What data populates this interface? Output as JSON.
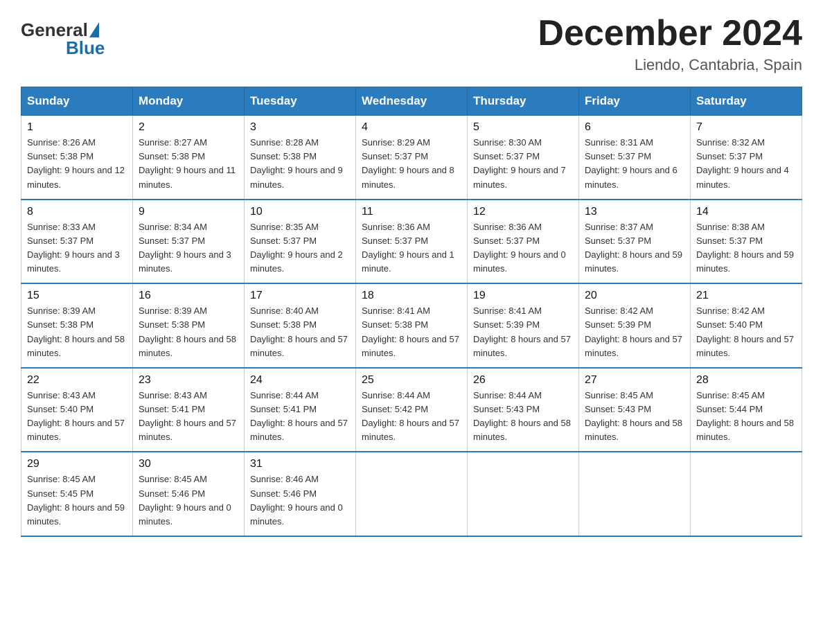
{
  "header": {
    "title": "December 2024",
    "location": "Liendo, Cantabria, Spain",
    "logo_general": "General",
    "logo_blue": "Blue"
  },
  "days_of_week": [
    "Sunday",
    "Monday",
    "Tuesday",
    "Wednesday",
    "Thursday",
    "Friday",
    "Saturday"
  ],
  "weeks": [
    [
      {
        "day": "1",
        "sunrise": "8:26 AM",
        "sunset": "5:38 PM",
        "daylight": "9 hours and 12 minutes."
      },
      {
        "day": "2",
        "sunrise": "8:27 AM",
        "sunset": "5:38 PM",
        "daylight": "9 hours and 11 minutes."
      },
      {
        "day": "3",
        "sunrise": "8:28 AM",
        "sunset": "5:38 PM",
        "daylight": "9 hours and 9 minutes."
      },
      {
        "day": "4",
        "sunrise": "8:29 AM",
        "sunset": "5:37 PM",
        "daylight": "9 hours and 8 minutes."
      },
      {
        "day": "5",
        "sunrise": "8:30 AM",
        "sunset": "5:37 PM",
        "daylight": "9 hours and 7 minutes."
      },
      {
        "day": "6",
        "sunrise": "8:31 AM",
        "sunset": "5:37 PM",
        "daylight": "9 hours and 6 minutes."
      },
      {
        "day": "7",
        "sunrise": "8:32 AM",
        "sunset": "5:37 PM",
        "daylight": "9 hours and 4 minutes."
      }
    ],
    [
      {
        "day": "8",
        "sunrise": "8:33 AM",
        "sunset": "5:37 PM",
        "daylight": "9 hours and 3 minutes."
      },
      {
        "day": "9",
        "sunrise": "8:34 AM",
        "sunset": "5:37 PM",
        "daylight": "9 hours and 3 minutes."
      },
      {
        "day": "10",
        "sunrise": "8:35 AM",
        "sunset": "5:37 PM",
        "daylight": "9 hours and 2 minutes."
      },
      {
        "day": "11",
        "sunrise": "8:36 AM",
        "sunset": "5:37 PM",
        "daylight": "9 hours and 1 minute."
      },
      {
        "day": "12",
        "sunrise": "8:36 AM",
        "sunset": "5:37 PM",
        "daylight": "9 hours and 0 minutes."
      },
      {
        "day": "13",
        "sunrise": "8:37 AM",
        "sunset": "5:37 PM",
        "daylight": "8 hours and 59 minutes."
      },
      {
        "day": "14",
        "sunrise": "8:38 AM",
        "sunset": "5:37 PM",
        "daylight": "8 hours and 59 minutes."
      }
    ],
    [
      {
        "day": "15",
        "sunrise": "8:39 AM",
        "sunset": "5:38 PM",
        "daylight": "8 hours and 58 minutes."
      },
      {
        "day": "16",
        "sunrise": "8:39 AM",
        "sunset": "5:38 PM",
        "daylight": "8 hours and 58 minutes."
      },
      {
        "day": "17",
        "sunrise": "8:40 AM",
        "sunset": "5:38 PM",
        "daylight": "8 hours and 57 minutes."
      },
      {
        "day": "18",
        "sunrise": "8:41 AM",
        "sunset": "5:38 PM",
        "daylight": "8 hours and 57 minutes."
      },
      {
        "day": "19",
        "sunrise": "8:41 AM",
        "sunset": "5:39 PM",
        "daylight": "8 hours and 57 minutes."
      },
      {
        "day": "20",
        "sunrise": "8:42 AM",
        "sunset": "5:39 PM",
        "daylight": "8 hours and 57 minutes."
      },
      {
        "day": "21",
        "sunrise": "8:42 AM",
        "sunset": "5:40 PM",
        "daylight": "8 hours and 57 minutes."
      }
    ],
    [
      {
        "day": "22",
        "sunrise": "8:43 AM",
        "sunset": "5:40 PM",
        "daylight": "8 hours and 57 minutes."
      },
      {
        "day": "23",
        "sunrise": "8:43 AM",
        "sunset": "5:41 PM",
        "daylight": "8 hours and 57 minutes."
      },
      {
        "day": "24",
        "sunrise": "8:44 AM",
        "sunset": "5:41 PM",
        "daylight": "8 hours and 57 minutes."
      },
      {
        "day": "25",
        "sunrise": "8:44 AM",
        "sunset": "5:42 PM",
        "daylight": "8 hours and 57 minutes."
      },
      {
        "day": "26",
        "sunrise": "8:44 AM",
        "sunset": "5:43 PM",
        "daylight": "8 hours and 58 minutes."
      },
      {
        "day": "27",
        "sunrise": "8:45 AM",
        "sunset": "5:43 PM",
        "daylight": "8 hours and 58 minutes."
      },
      {
        "day": "28",
        "sunrise": "8:45 AM",
        "sunset": "5:44 PM",
        "daylight": "8 hours and 58 minutes."
      }
    ],
    [
      {
        "day": "29",
        "sunrise": "8:45 AM",
        "sunset": "5:45 PM",
        "daylight": "8 hours and 59 minutes."
      },
      {
        "day": "30",
        "sunrise": "8:45 AM",
        "sunset": "5:46 PM",
        "daylight": "9 hours and 0 minutes."
      },
      {
        "day": "31",
        "sunrise": "8:46 AM",
        "sunset": "5:46 PM",
        "daylight": "9 hours and 0 minutes."
      },
      null,
      null,
      null,
      null
    ]
  ]
}
